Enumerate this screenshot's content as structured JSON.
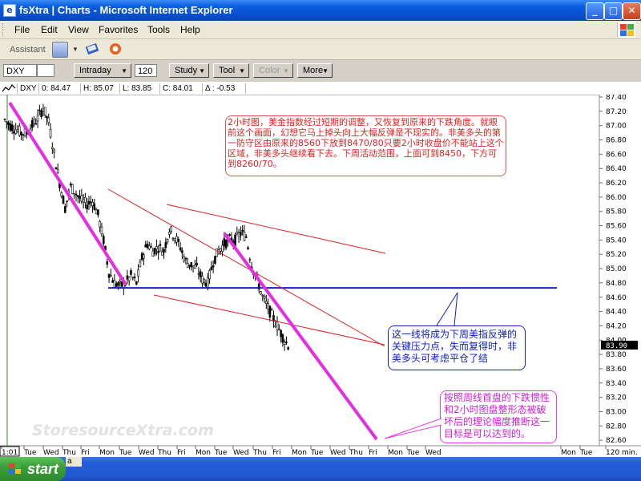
{
  "window": {
    "title": "fsXtra | Charts - Microsoft Internet Explorer",
    "app_icon": "ie-icon",
    "controls": {
      "minimize": "_",
      "maximize": "□",
      "close": "✕"
    }
  },
  "menubar": {
    "items": [
      "File",
      "Edit",
      "View",
      "Favorites",
      "Tools",
      "Help"
    ]
  },
  "assistant_bar": {
    "label": "Assistant"
  },
  "chart_toolbar": {
    "symbol": "DXY",
    "period": "Intraday",
    "bars": "120",
    "buttons": [
      "Study",
      "Tool",
      "Color",
      "More"
    ]
  },
  "quote_bar": {
    "symbol": "DXY",
    "open": "0: 84.47",
    "high": "H: 85.07",
    "low": "L: 83.85",
    "close": "C: 84.01",
    "change": "Δ : -0.53"
  },
  "annotations": {
    "red": "2小时图，美金指数经过短期的调整，又恢复到原来的下跌角度。就眼前这个画面，幻想它马上掉头向上大幅反弹是不现实的。非美多头的第一防守区由原来的8560下放到8470/80只要2小时收盘价不能站上这个区域，非美多头继续看下去。下周活动范围，上面可到8450，下方可到8260/70。",
    "blue": "这一线将成为下周美指反弹的关键压力点，失而复得时，非美多头可考虑平仓了结",
    "pink": "按照周线首盘的下跌惯性和2小时图盘整形态被破坏后的理论幅度推断这一目标是可以达到的。"
  },
  "watermark": "StoresourceXtra.com",
  "last_price_tag": "83.90",
  "taskbar": {
    "start_label": "start",
    "task_text": "a"
  },
  "chart_data": {
    "type": "candlestick",
    "title": "",
    "y_axis_labels": [
      "87.40",
      "87.20",
      "87.00",
      "86.80",
      "86.60",
      "86.40",
      "86.20",
      "86.00",
      "85.80",
      "85.60",
      "85.40",
      "85.20",
      "85.00",
      "84.80",
      "84.60",
      "84.40",
      "84.20",
      "84.00",
      "83.80",
      "83.60",
      "83.40",
      "83.20",
      "83.00",
      "82.80",
      "82.60"
    ],
    "ylim": [
      82.55,
      87.5
    ],
    "x_axis_labels": [
      "1:01",
      "Tue",
      "Wed",
      "Thu",
      "Fri",
      "Mon",
      "Tue",
      "Wed",
      "Thu",
      "Fri",
      "Mon",
      "Tue",
      "Wed",
      "Thu",
      "Fri",
      "Mon",
      "Tue",
      "Wed",
      "Thu",
      "Fri",
      "Mon",
      "Tue",
      "Wed",
      "Mon",
      "Tue",
      "120 min."
    ],
    "horizontal_line": 84.73,
    "close_approx": [
      87.08,
      87.0,
      86.95,
      86.9,
      86.9,
      87.0,
      87.1,
      87.25,
      87.05,
      86.6,
      86.2,
      85.85,
      86.15,
      86.05,
      85.95,
      85.9,
      85.95,
      85.75,
      85.4,
      84.95,
      84.8,
      84.75,
      84.8,
      84.9,
      84.8,
      85.15,
      85.35,
      85.25,
      85.3,
      85.25,
      85.55,
      85.45,
      85.3,
      85.1,
      85.05,
      85.0,
      84.85,
      84.8,
      85.1,
      85.25,
      85.35,
      85.4,
      85.4,
      85.5,
      85.45,
      85.05,
      84.85,
      84.6,
      84.45,
      84.3,
      84.15,
      84.0,
      83.9
    ]
  }
}
